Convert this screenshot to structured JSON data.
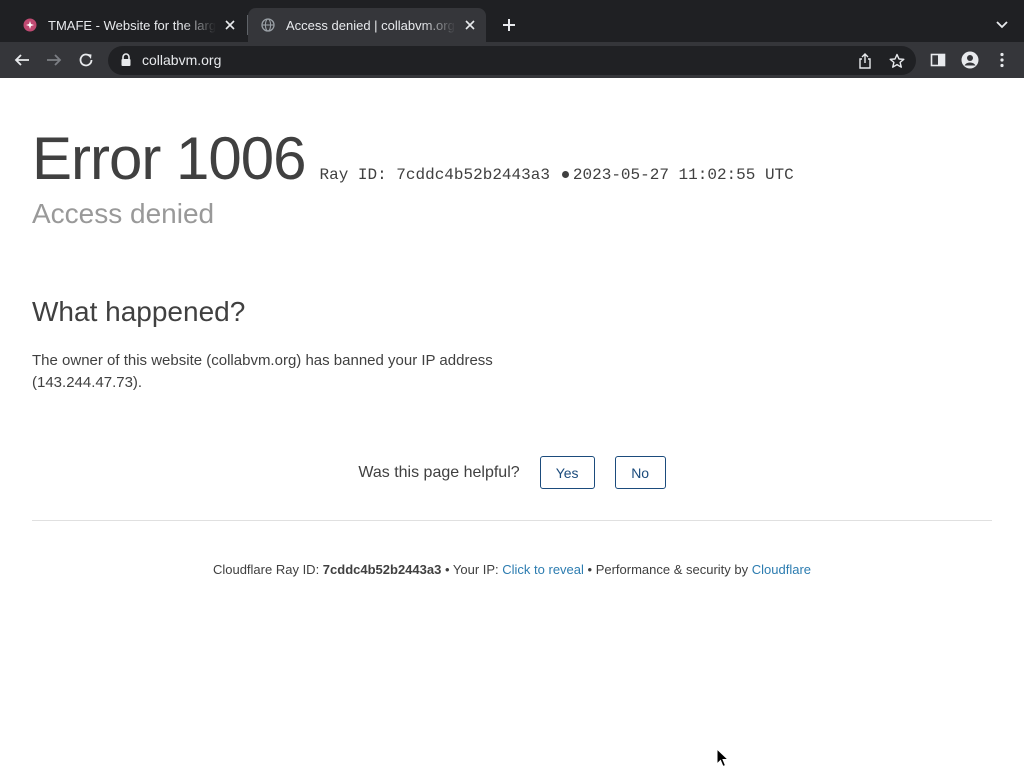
{
  "browser": {
    "tabs": [
      {
        "title": "TMAFE - Website for the largest",
        "favicon": "tmafe-favicon",
        "active": false
      },
      {
        "title": "Access denied | collabvm.org used",
        "favicon": "globe-icon",
        "active": true
      }
    ],
    "address": "collabvm.org",
    "colors": {
      "tabstrip": "#1f2023",
      "toolbar": "#35363a",
      "omnibox": "#202124"
    }
  },
  "page": {
    "error_code": "Error 1006",
    "ray_label": "Ray ID: 7cddc4b52b2443a3",
    "timestamp": "2023-05-27 11:02:55 UTC",
    "subtitle": "Access denied",
    "section_title": "What happened?",
    "section_text": "The owner of this website (collabvm.org) has banned your IP address (143.244.47.73).",
    "feedback": {
      "question": "Was this page helpful?",
      "yes": "Yes",
      "no": "No"
    },
    "footer": {
      "ray_prefix": "Cloudflare Ray ID: ",
      "ray_id": "7cddc4b52b2443a3",
      "sep1": " • ",
      "ip_prefix": "Your IP: ",
      "ip_link": "Click to reveal",
      "sep2": " • ",
      "perf_prefix": "Performance & security by ",
      "cloudflare_link": "Cloudflare"
    },
    "colors": {
      "text": "#404040",
      "muted": "#999999",
      "link": "#2c7cb0",
      "button": "#1b4b7c"
    }
  }
}
